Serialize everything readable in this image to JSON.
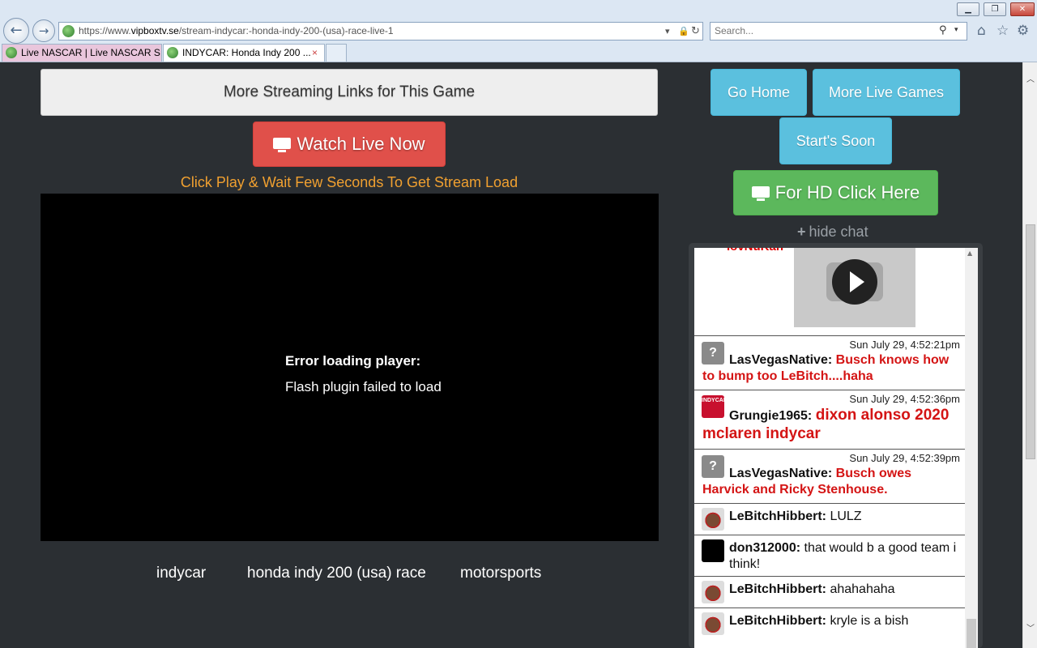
{
  "browser": {
    "url_prefix": "https://www.",
    "url_host": "vipboxtv.se",
    "url_path": "/stream-indycar:-honda-indy-200-(usa)-race-live-1",
    "search_placeholder": "Search...",
    "tabs": [
      {
        "label": "Live NASCAR | Live NASCAR S..."
      },
      {
        "label": "INDYCAR: Honda Indy 200 ..."
      }
    ],
    "tab_close_glyph": "×",
    "window_controls": {
      "minimize": "▁",
      "maximize": "❐",
      "close": "✕"
    },
    "nav": {
      "back": "←",
      "forward": "→"
    },
    "icons": {
      "home": "⌂",
      "favorites": "☆",
      "tools": "⚙",
      "search": "⚲",
      "dropdown": "▾",
      "lock": "🔒",
      "refresh": "↻"
    }
  },
  "page": {
    "more_links_label": "More Streaming Links for This Game",
    "watch_live_label": "Watch Live Now",
    "play_hint": "Click Play & Wait Few Seconds To Get Stream Load",
    "player": {
      "error_title": "Error loading player:",
      "error_message": "Flash plugin failed to load"
    },
    "tags": [
      "indycar",
      "honda indy 200 (usa) race",
      "motorsports"
    ],
    "sidebar": {
      "go_home": "Go Home",
      "more_live_games": "More Live Games",
      "starts_soon": "Start's Soon",
      "hd_click": "For HD Click Here",
      "hide_chat": "hide chat",
      "hide_chat_icon": "+"
    }
  },
  "chat": {
    "partial_top_name": "lovNuKah",
    "video_thumb_icon": "play-icon",
    "messages": [
      {
        "time": "Sun July 29, 4:52:21pm",
        "user": "LasVegasNative:",
        "text": "Busch knows how to bump too LeBitch....haha",
        "avatar": "?"
      },
      {
        "time": "Sun July 29, 4:52:36pm",
        "user": "Grungie1965:",
        "text": "dixon alonso 2020 mclaren indycar",
        "avatar": "INDYCAR"
      },
      {
        "time": "Sun July 29, 4:52:39pm",
        "user": "LasVegasNative:",
        "text": "Busch owes Harvick and Ricky Stenhouse.",
        "avatar": "?"
      },
      {
        "time": "",
        "user": "LeBitchHibbert:",
        "text": "LULZ",
        "avatar": ""
      },
      {
        "time": "",
        "user": "don312000:",
        "text": "that would b a good team i think!",
        "avatar": ""
      },
      {
        "time": "",
        "user": "LeBitchHibbert:",
        "text": "ahahahaha",
        "avatar": ""
      },
      {
        "time": "",
        "user": "LeBitchHibbert:",
        "text": "kryle is a bish",
        "avatar": ""
      }
    ]
  },
  "colors": {
    "page_bg": "#2b2f33",
    "danger": "#e0504a",
    "info": "#5bc0de",
    "success": "#5cb85c",
    "hint": "#f0a030",
    "chat_red": "#d41414"
  }
}
